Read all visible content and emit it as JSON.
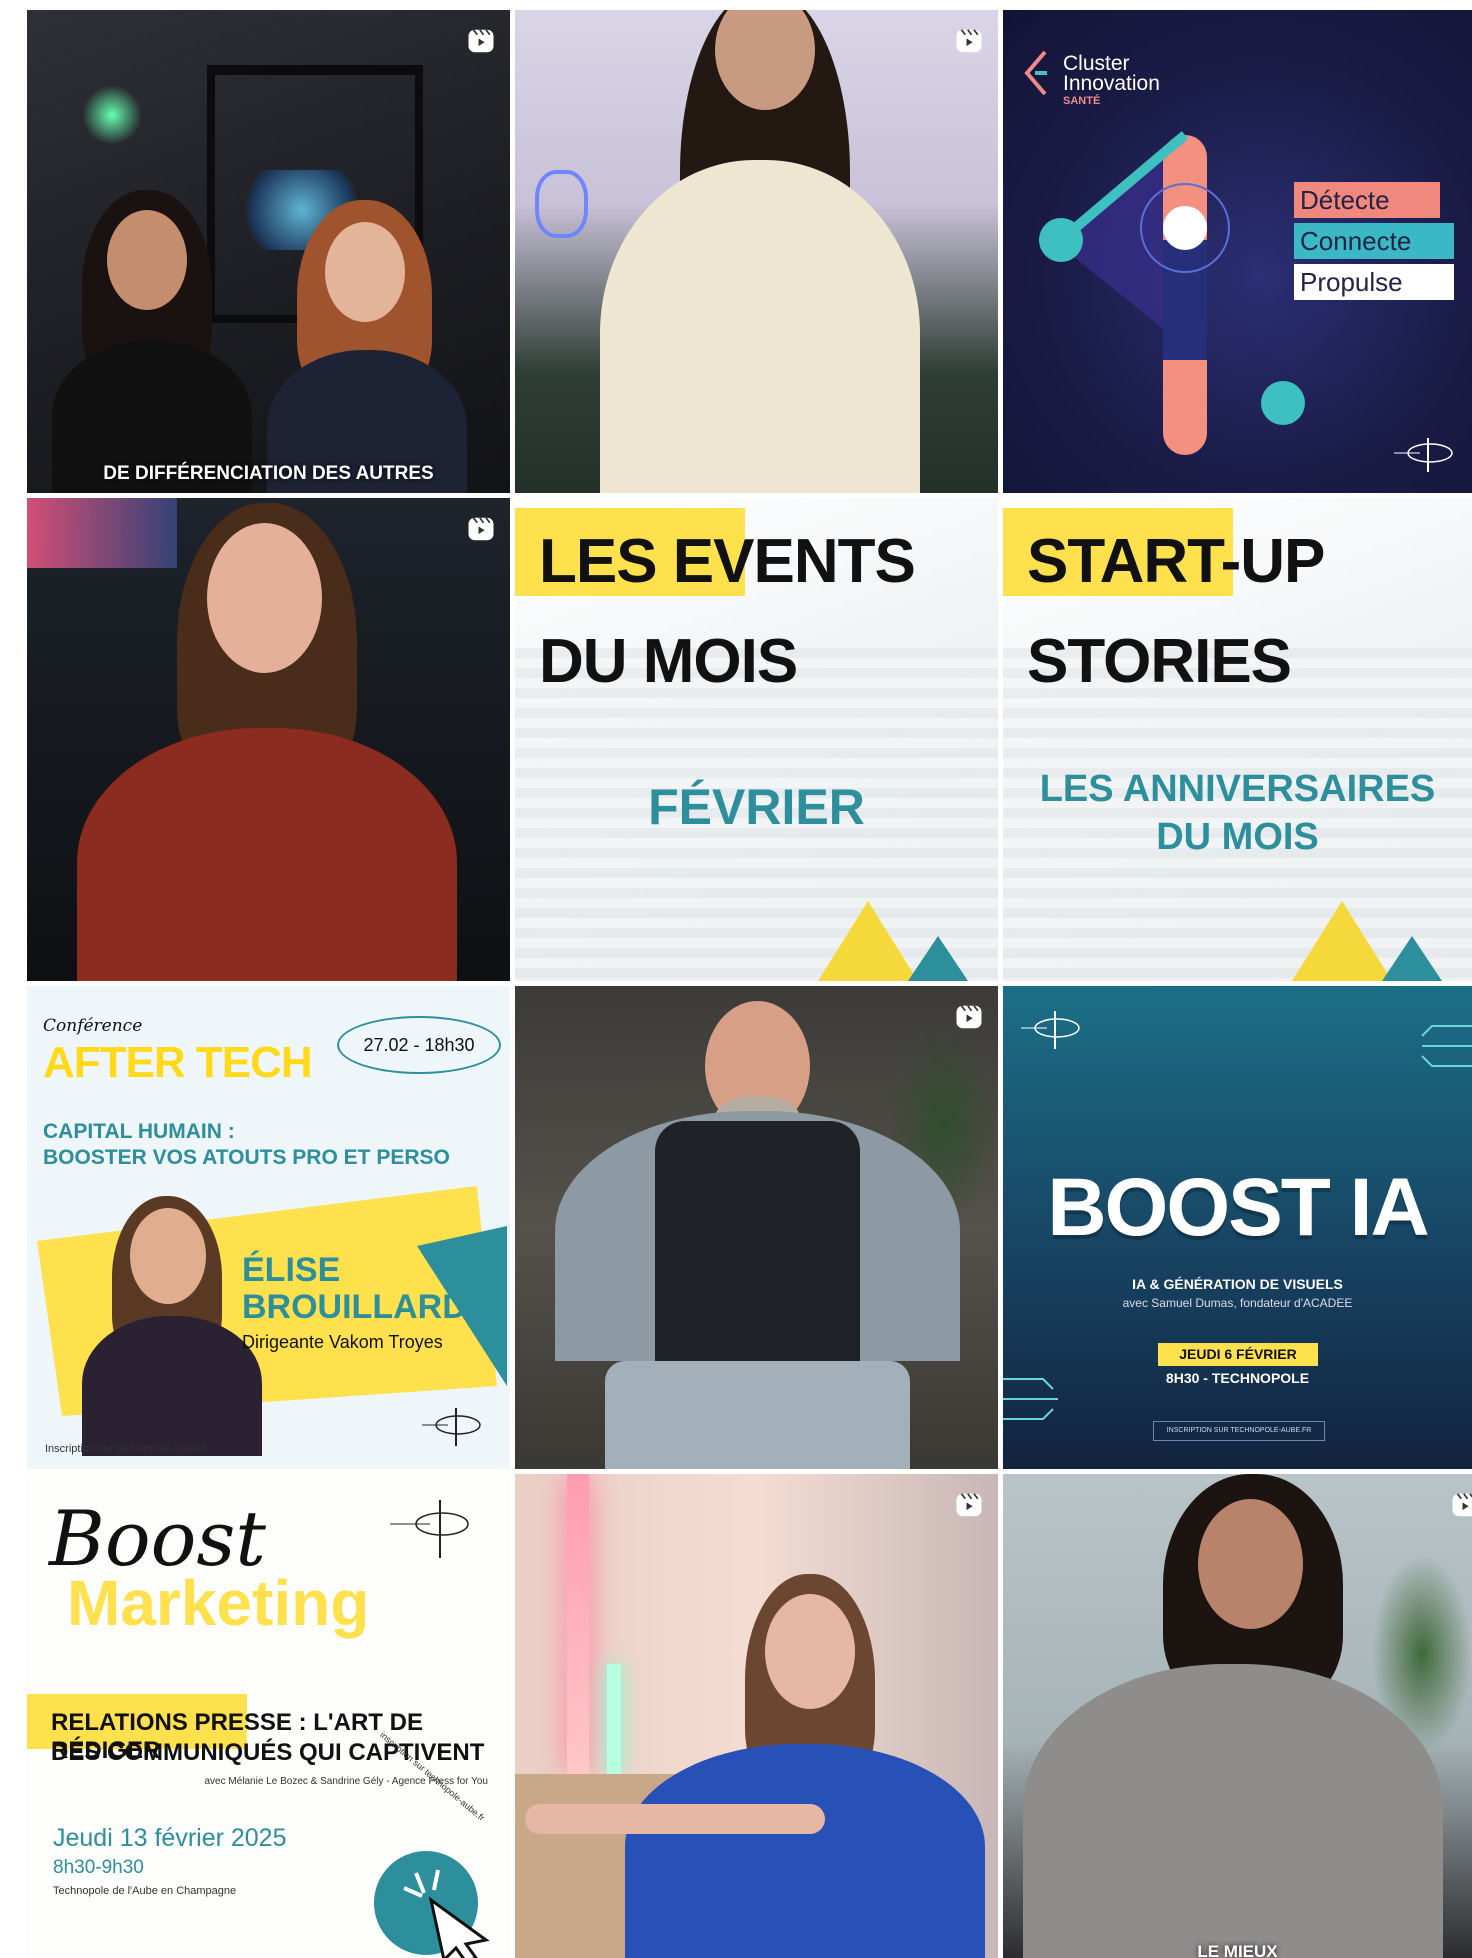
{
  "tiles": {
    "t1": {
      "caption": "DE DIFFÉRENCIATION DES AUTRES"
    },
    "t3": {
      "title_line1": "Cluster",
      "title_line2": "Innovation",
      "subtitle": "SANTÉ",
      "tags": [
        "Détecte",
        "Connecte",
        "Propulse"
      ]
    },
    "t5": {
      "line1": "LES EVENTS",
      "line2": "DU MOIS",
      "sub": "FÉVRIER"
    },
    "t6": {
      "line1": "START-UP",
      "line2": "STORIES",
      "sub1": "LES ANNIVERSAIRES",
      "sub2": "DU MOIS"
    },
    "t7": {
      "kicker": "Conférence",
      "title": "AFTER TECH",
      "date": "27.02 - 18h30",
      "theme1": "CAPITAL HUMAIN :",
      "theme2": "BOOSTER VOS ATOUTS PRO ET PERSO",
      "speaker1": "ÉLISE",
      "speaker2": "BROUILLARD",
      "role": "Dirigeante Vakom Troyes",
      "footer": "Inscription sur technopole-aube.fr"
    },
    "t9": {
      "title": "BOOST IA",
      "sub": "IA & GÉNÉRATION DE VISUELS",
      "with": "avec Samuel Dumas, fondateur d'ACADEE",
      "date": "JEUDI 6 FÉVRIER",
      "time": "8H30 - TECHNOPOLE",
      "cta": "INSCRIPTION SUR TECHNOPOLE-AUBE.FR"
    },
    "t10": {
      "script": "Boost",
      "title": "Marketing",
      "line1": "RELATIONS PRESSE : L'ART DE RÉDIGER",
      "line2": "DES COMMUNIQUÉS QUI CAPTIVENT",
      "with": "avec Mélanie Le Bozec & Sandrine Gély - Agence Press for You",
      "date": "Jeudi 13 février 2025",
      "time": "8h30-9h30",
      "place": "Technopole de l'Aube en Champagne",
      "badge": "inscription sur technopole-aube.fr"
    },
    "t12": {
      "caption": "LE MIEUX"
    }
  },
  "brand": {
    "teal": "#2d8f9b",
    "yellow": "#ffe14d",
    "navy": "#15233f"
  },
  "icons": {
    "reel": "reel-icon"
  }
}
